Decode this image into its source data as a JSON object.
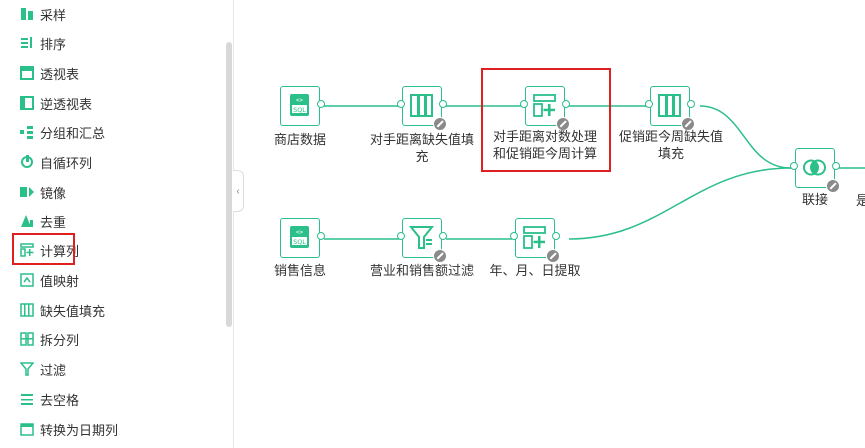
{
  "sidebar": {
    "items": [
      {
        "label": "采样",
        "icon": "sample-icon"
      },
      {
        "label": "排序",
        "icon": "sort-icon"
      },
      {
        "label": "透视表",
        "icon": "pivot-icon"
      },
      {
        "label": "逆透视表",
        "icon": "unpivot-icon"
      },
      {
        "label": "分组和汇总",
        "icon": "group-icon"
      },
      {
        "label": "自循环列",
        "icon": "loop-icon"
      },
      {
        "label": "镜像",
        "icon": "mirror-icon"
      },
      {
        "label": "去重",
        "icon": "dedupe-icon"
      },
      {
        "label": "计算列",
        "icon": "calc-column-icon"
      },
      {
        "label": "值映射",
        "icon": "value-map-icon"
      },
      {
        "label": "缺失值填充",
        "icon": "fill-missing-icon"
      },
      {
        "label": "拆分列",
        "icon": "split-column-icon"
      },
      {
        "label": "过滤",
        "icon": "filter-icon"
      },
      {
        "label": "去空格",
        "icon": "trim-icon"
      },
      {
        "label": "转换为日期列",
        "icon": "date-convert-icon"
      }
    ],
    "highlighted_index": 8
  },
  "flow": {
    "nodes": [
      {
        "label": "商店数据",
        "icon": "sql-icon"
      },
      {
        "label": "对手距离缺失值填\n充",
        "icon": "fill-missing-icon"
      },
      {
        "label": "对手距离对数处理\n和促销距今周计算",
        "icon": "calc-column-icon"
      },
      {
        "label": "促销距今周缺失值\n填充",
        "icon": "fill-missing-icon"
      },
      {
        "label": "联接",
        "icon": "join-icon"
      },
      {
        "label": "销售信息",
        "icon": "sql-icon"
      },
      {
        "label": "营业和销售额过滤",
        "icon": "filter-icon"
      },
      {
        "label": "年、月、日提取",
        "icon": "calc-column-icon"
      },
      {
        "label": "是",
        "icon": ""
      }
    ]
  },
  "colors": {
    "accent": "#2bbf8a",
    "highlight": "#e02020"
  }
}
